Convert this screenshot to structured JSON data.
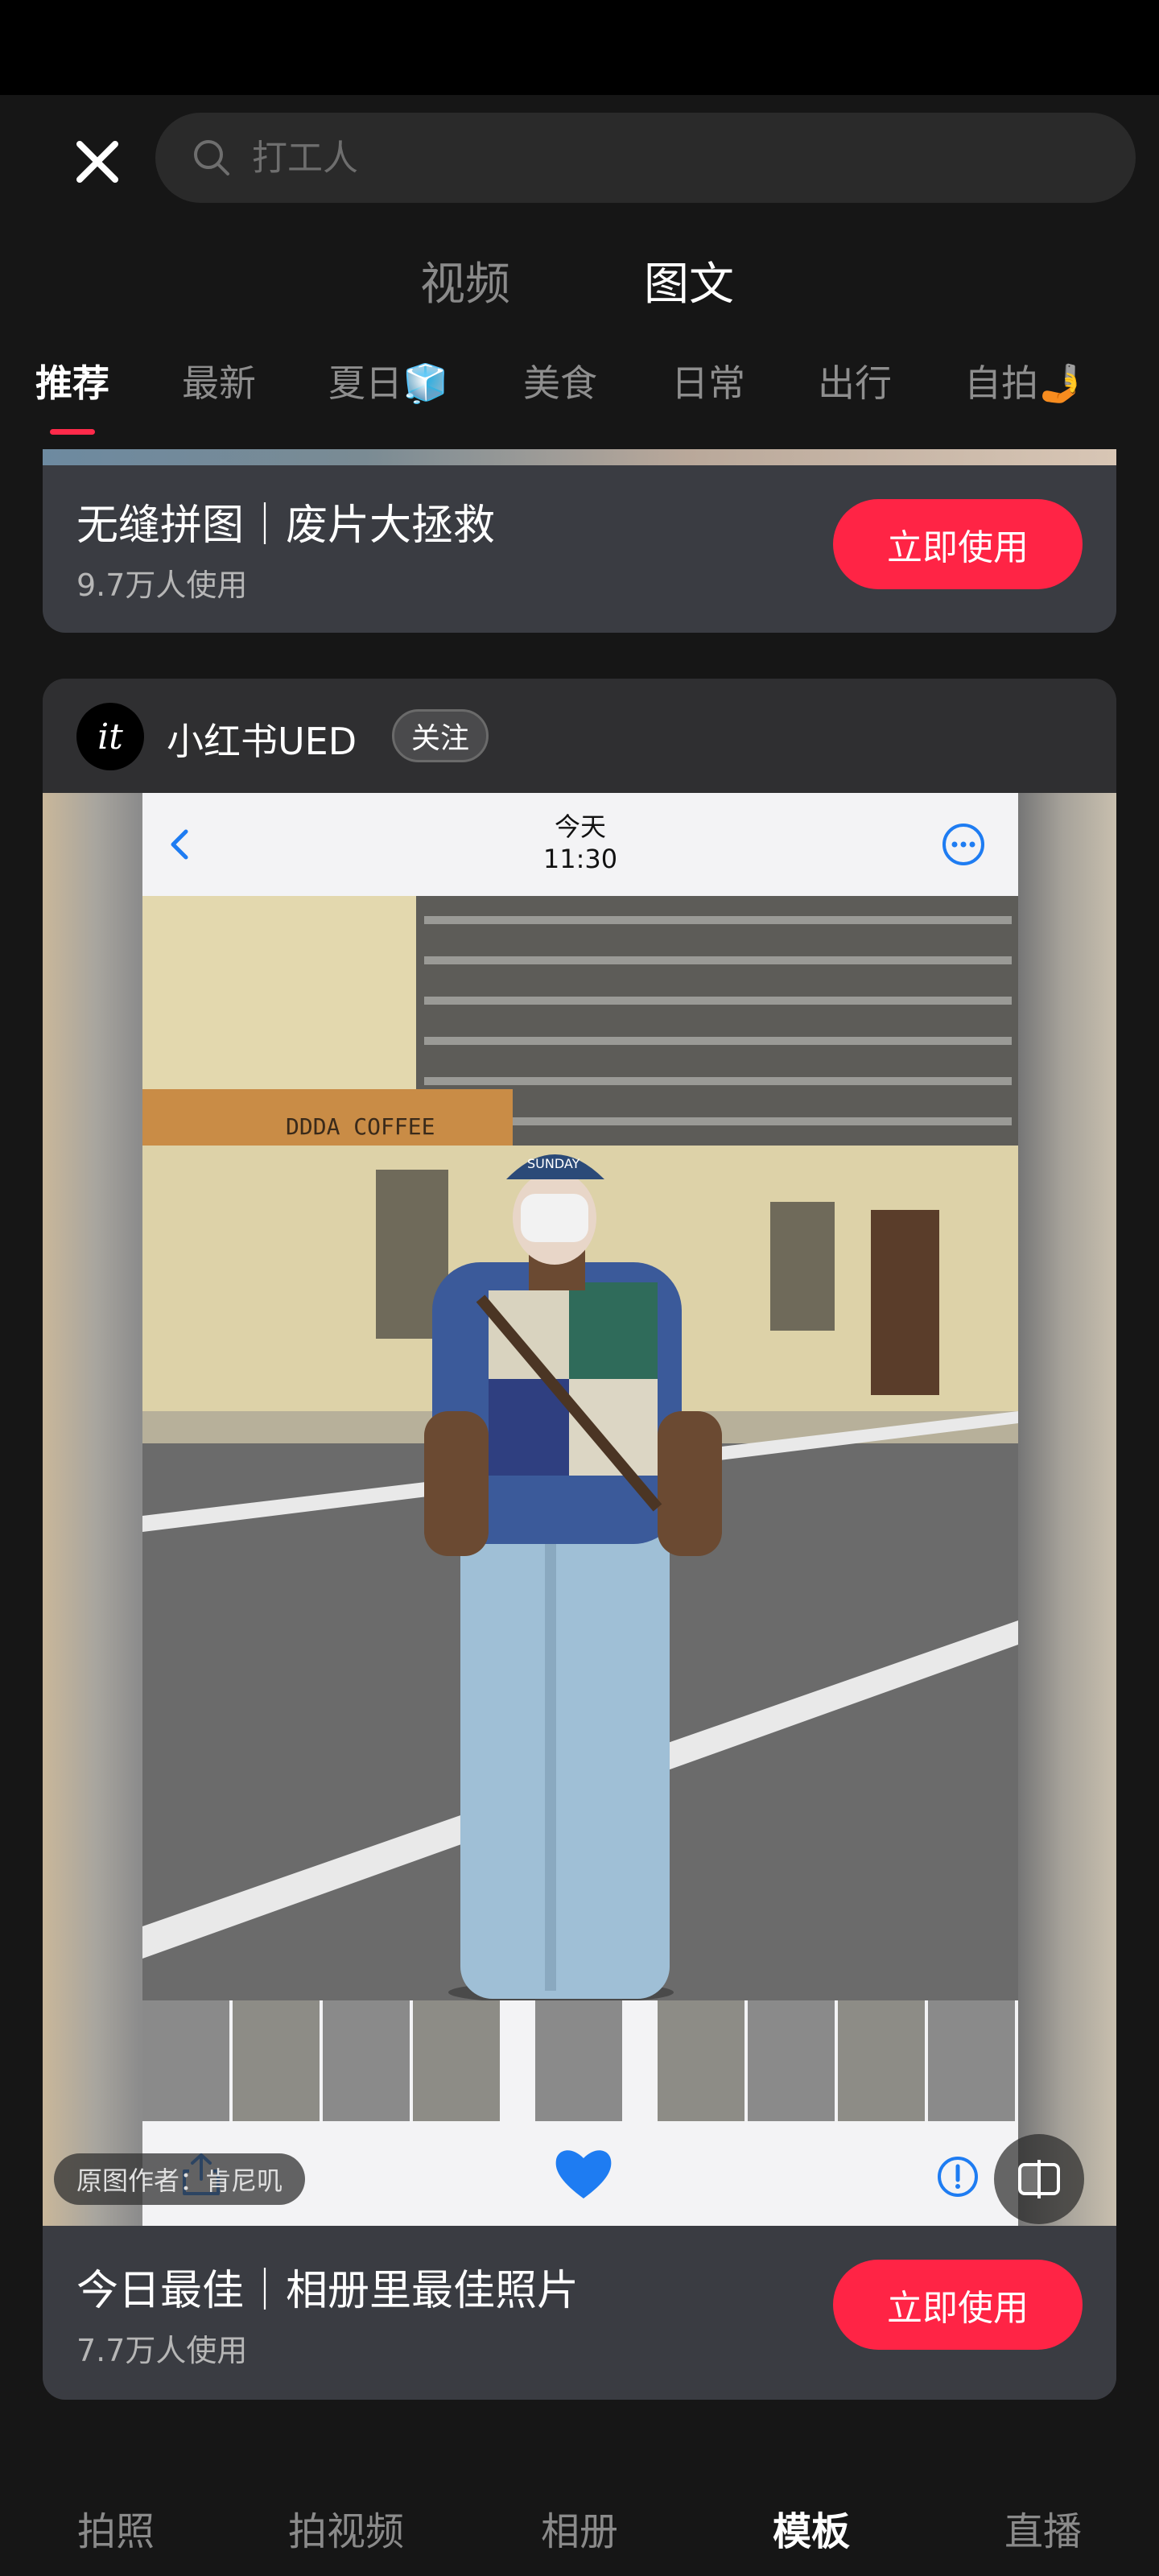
{
  "search": {
    "placeholder": "打工人"
  },
  "mode_tabs": [
    {
      "label": "视频",
      "active": false
    },
    {
      "label": "图文",
      "active": true
    }
  ],
  "category_tabs": [
    {
      "label": "推荐",
      "active": true
    },
    {
      "label": "最新"
    },
    {
      "label": "夏日🧊"
    },
    {
      "label": "美食"
    },
    {
      "label": "日常"
    },
    {
      "label": "出行"
    },
    {
      "label": "自拍🤳"
    }
  ],
  "cards": [
    {
      "title": "无缝拼图｜废片大拯救",
      "usage": "9.7万人使用",
      "button": "立即使用"
    },
    {
      "author": "小红书UED",
      "avatar_text": "it",
      "follow": "关注",
      "preview": {
        "date_line1": "今天",
        "date_line2": "11:30",
        "sign_text": "DDDA COFFEE",
        "cap_text": "SUNDAY",
        "credit": "原图作者：肯尼叽"
      },
      "title": "今日最佳｜相册里最佳照片",
      "usage": "7.7万人使用",
      "button": "立即使用"
    }
  ],
  "bottom_nav": [
    {
      "label": "拍照"
    },
    {
      "label": "拍视频"
    },
    {
      "label": "相册"
    },
    {
      "label": "模板",
      "active": true
    },
    {
      "label": "直播"
    }
  ],
  "colors": {
    "accent": "#ff2445",
    "background": "#161616",
    "card": "#2f2f31",
    "ios_blue": "#1e7cf2"
  },
  "icons": {
    "close": "close-icon",
    "search": "search-icon",
    "back": "chevron-left-icon",
    "more": "more-circle-icon",
    "share": "share-icon",
    "like": "heart-icon",
    "info": "info-icon",
    "toggle": "compare-toggle-icon"
  }
}
